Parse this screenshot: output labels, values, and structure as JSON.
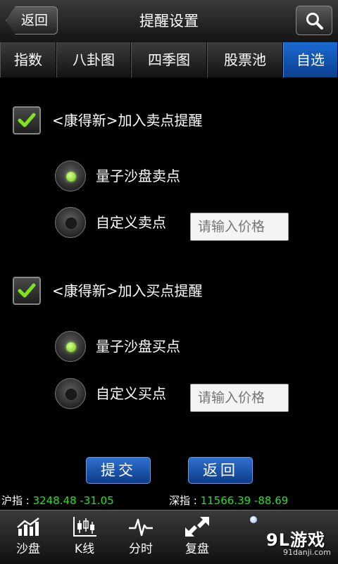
{
  "header": {
    "back_label": "返回",
    "title": "提醒设置"
  },
  "tabs": [
    {
      "label": "指数"
    },
    {
      "label": "八卦图"
    },
    {
      "label": "四季图"
    },
    {
      "label": "股票池"
    },
    {
      "label": "自选",
      "active": true
    }
  ],
  "sell_section": {
    "checkbox_label": "<康得新>加入卖点提醒",
    "checked": true,
    "options": [
      {
        "label": "量子沙盘卖点",
        "selected": true
      },
      {
        "label": "自定义卖点",
        "selected": false
      }
    ],
    "price_placeholder": "请输入价格"
  },
  "buy_section": {
    "checkbox_label": "<康得新>加入买点提醒",
    "checked": true,
    "options": [
      {
        "label": "量子沙盘买点",
        "selected": true
      },
      {
        "label": "自定义买点",
        "selected": false
      }
    ],
    "price_placeholder": "请输入价格"
  },
  "actions": {
    "submit_label": "提交",
    "return_label": "返回"
  },
  "ticker": {
    "sh_name": "沪指 : ",
    "sh_value": "3248.48 -31.05",
    "sz_name": "深指 : ",
    "sz_value": "11566.39 -88.69"
  },
  "bottom_nav": [
    {
      "label": "沙盘",
      "icon": "bar-chart-icon"
    },
    {
      "label": "K线",
      "icon": "candlestick-icon"
    },
    {
      "label": "分时",
      "icon": "pulse-line-icon"
    },
    {
      "label": "复盘",
      "icon": "expand-arrows-icon"
    }
  ],
  "watermark": {
    "main": "9L游戏",
    "sub": "91danji.com"
  },
  "colors": {
    "accent_blue": "#0a3f8f",
    "ticker_green": "#22e322",
    "radio_green": "#6cc21a"
  }
}
